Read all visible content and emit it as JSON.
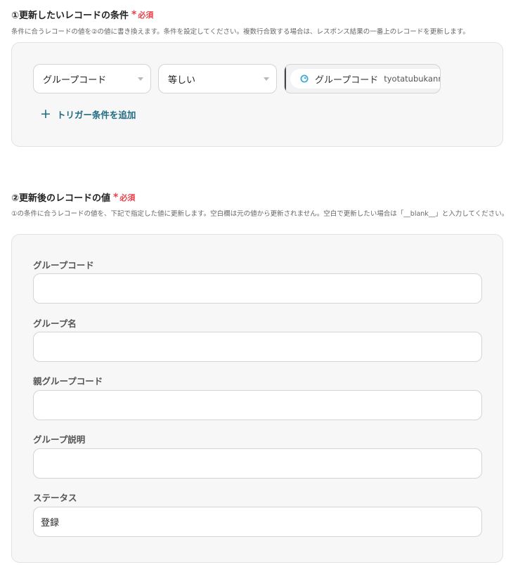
{
  "section1": {
    "title": "①更新したいレコードの条件",
    "required_star": "*",
    "required_label": "必須",
    "description": "条件に合うレコードの値を②の値に書き換えます。条件を設定してください。複数行合致する場合は、レスポンス結果の一番上のレコードを更新します。",
    "condition": {
      "field_select": "グループコード",
      "operator_select": "等しい",
      "value_chip_label": "グループコード",
      "value_chip_sub": "tyotatubukanr"
    },
    "add_trigger_label": "トリガー条件を追加"
  },
  "section2": {
    "title": "②更新後のレコードの値",
    "required_star": "*",
    "required_label": "必須",
    "description": "①の条件に合うレコードの値を、下記で指定した値に更新します。空白欄は元の値から更新されません。空白で更新したい場合は「__blank__」と入力してください。",
    "fields": [
      {
        "label": "グループコード",
        "value": ""
      },
      {
        "label": "グループ名",
        "value": ""
      },
      {
        "label": "親グループコード",
        "value": ""
      },
      {
        "label": "グループ説明",
        "value": ""
      },
      {
        "label": "ステータス",
        "value": "登録"
      }
    ]
  },
  "colors": {
    "required": "#e8424b",
    "link": "#1f6b82",
    "chip_icon": "#3fa9d6"
  },
  "icons": {
    "select_caret": "chevron-down-icon",
    "chip_icon": "data-source-icon",
    "add": "plus-icon"
  }
}
